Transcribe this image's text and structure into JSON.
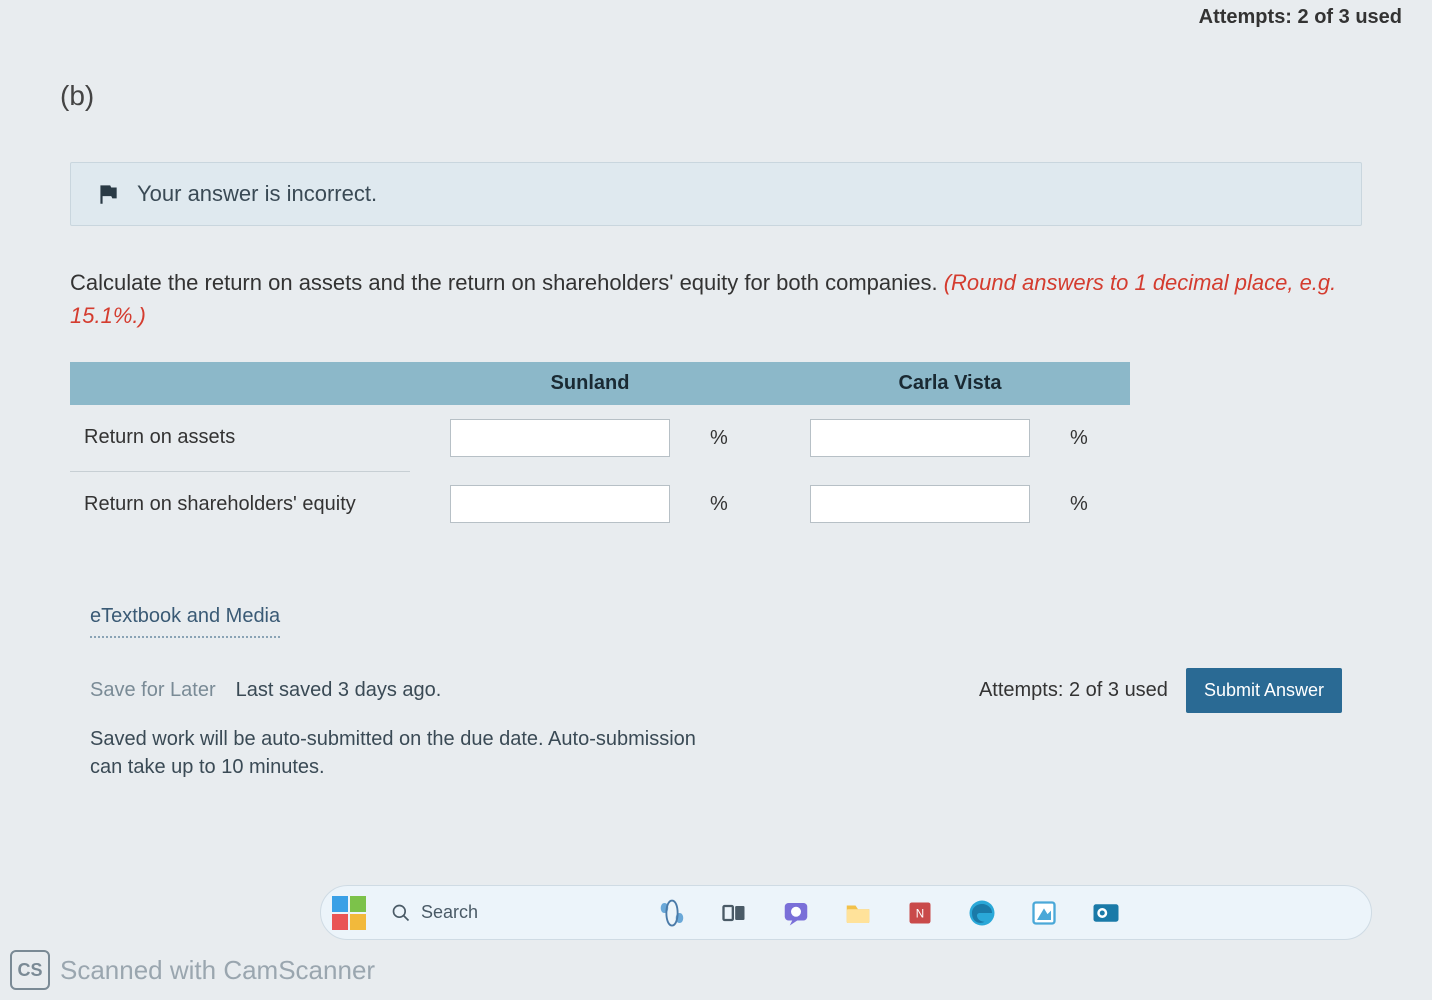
{
  "header": {
    "top_attempts": "Attempts: 2 of 3 used"
  },
  "part_label": "(b)",
  "feedback": {
    "message": "Your answer is incorrect."
  },
  "question": {
    "prompt": "Calculate the return on assets and the return on shareholders' equity for both companies. ",
    "hint": "(Round answers to 1 decimal place, e.g. 15.1%.)"
  },
  "table": {
    "col1_header": "Sunland",
    "col2_header": "Carla Vista",
    "rows": [
      {
        "label": "Return on assets",
        "unit": "%",
        "val1": "",
        "val2": ""
      },
      {
        "label": "Return on shareholders' equity",
        "unit": "%",
        "val1": "",
        "val2": ""
      }
    ]
  },
  "resources": {
    "etextbook": "eTextbook and Media"
  },
  "save": {
    "save_for_later": "Save for Later",
    "last_saved": "Last saved 3 days ago.",
    "attempts": "Attempts: 2 of 3 used",
    "submit": "Submit Answer",
    "autosave_note": "Saved work will be auto-submitted on the due date. Auto-submission can take up to 10 minutes."
  },
  "taskbar": {
    "search_label": "Search"
  },
  "scanner": {
    "badge": "CS",
    "text": "Scanned with CamScanner"
  }
}
